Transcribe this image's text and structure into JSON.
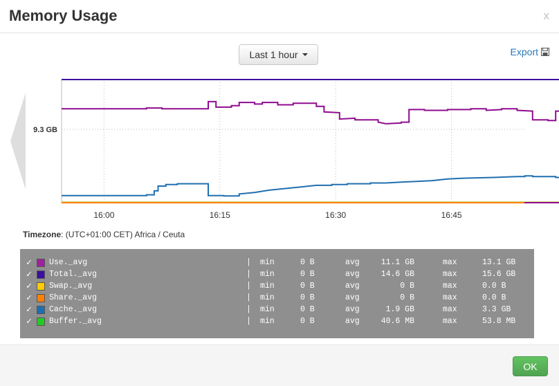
{
  "modal": {
    "title": "Memory Usage",
    "close_label": "x",
    "range_label": "Last 1 hour",
    "export_label": "Export",
    "ok_label": "OK"
  },
  "timezone": {
    "label": "Timezone",
    "value": ": (UTC+01:00 CET) Africa / Ceuta"
  },
  "chart_data": {
    "type": "line",
    "x_ticks": [
      "16:00",
      "16:15",
      "16:30",
      "16:45"
    ],
    "y_ticks": [
      {
        "label": "9.3 GB",
        "value": 9.3
      }
    ],
    "ylim": [
      0,
      15.6
    ],
    "grid": true,
    "series": [
      {
        "name": "Use._avg",
        "color": "#8f0b8f",
        "points": [
          [
            0,
            11.9
          ],
          [
            11,
            11.9
          ],
          [
            11,
            12.0
          ],
          [
            13,
            12.0
          ],
          [
            13,
            11.9
          ],
          [
            19,
            11.9
          ],
          [
            19,
            12.8
          ],
          [
            20,
            12.8
          ],
          [
            20,
            12.1
          ],
          [
            22,
            12.1
          ],
          [
            22,
            12.3
          ],
          [
            23,
            12.3
          ],
          [
            23,
            12.7
          ],
          [
            25,
            12.7
          ],
          [
            25,
            12.5
          ],
          [
            26,
            12.5
          ],
          [
            26,
            12.7
          ],
          [
            28,
            12.7
          ],
          [
            28,
            12.4
          ],
          [
            30,
            12.4
          ],
          [
            30,
            12.6
          ],
          [
            33,
            12.6
          ],
          [
            33,
            12.2
          ],
          [
            34,
            12.2
          ],
          [
            34,
            11.5
          ],
          [
            36,
            11.4
          ],
          [
            36,
            10.6
          ],
          [
            38,
            10.7
          ],
          [
            38,
            10.5
          ],
          [
            41,
            10.5
          ],
          [
            41,
            10.2
          ],
          [
            42,
            10.0
          ],
          [
            44,
            10.1
          ],
          [
            44,
            10.2
          ],
          [
            45,
            10.2
          ],
          [
            45,
            11.8
          ],
          [
            47,
            11.8
          ],
          [
            47,
            11.7
          ],
          [
            50,
            11.7
          ],
          [
            50,
            11.8
          ],
          [
            53,
            11.8
          ],
          [
            53,
            11.9
          ],
          [
            55,
            11.9
          ],
          [
            55,
            11.7
          ],
          [
            57,
            11.8
          ],
          [
            57,
            11.9
          ],
          [
            59,
            11.9
          ],
          [
            59,
            11.7
          ],
          [
            61,
            11.6
          ],
          [
            61,
            10.5
          ],
          [
            63,
            10.5
          ],
          [
            63,
            10.4
          ],
          [
            64,
            10.4
          ],
          [
            64,
            11.6
          ],
          [
            65,
            11.6
          ],
          [
            65,
            11.9
          ],
          [
            67,
            11.9
          ],
          [
            67,
            12.0
          ],
          [
            69,
            12.0
          ],
          [
            69,
            11.8
          ],
          [
            70,
            11.8
          ],
          [
            70,
            12.0
          ],
          [
            71,
            12.0
          ],
          [
            71,
            11.9
          ],
          [
            71.5,
            11.9
          ],
          [
            71.5,
            0
          ]
        ]
      },
      {
        "name": "Total._avg",
        "color": "#3a0fa0",
        "points": [
          [
            0,
            15.6
          ],
          [
            71.5,
            15.6
          ],
          [
            71.5,
            0
          ]
        ]
      },
      {
        "name": "Swap._avg",
        "color": "#f0c800",
        "points": [
          [
            0,
            0
          ],
          [
            71.5,
            0
          ]
        ]
      },
      {
        "name": "Share._avg",
        "color": "#ff7f00",
        "points": [
          [
            0,
            0
          ],
          [
            71.5,
            0
          ]
        ]
      },
      {
        "name": "Cache._avg",
        "color": "#1f6fb0",
        "points": [
          [
            0,
            0.9
          ],
          [
            11,
            0.9
          ],
          [
            11,
            1.0
          ],
          [
            12,
            1.0
          ],
          [
            12,
            1.5
          ],
          [
            12.5,
            1.5
          ],
          [
            12.5,
            2.1
          ],
          [
            13.5,
            2.1
          ],
          [
            13.5,
            2.3
          ],
          [
            15,
            2.3
          ],
          [
            15,
            2.4
          ],
          [
            19,
            2.4
          ],
          [
            19,
            0.9
          ],
          [
            21,
            0.9
          ],
          [
            21,
            0.85
          ],
          [
            23,
            0.85
          ],
          [
            23,
            1.1
          ],
          [
            25,
            1.3
          ],
          [
            27,
            1.6
          ],
          [
            29,
            1.8
          ],
          [
            31,
            2.0
          ],
          [
            33,
            2.2
          ],
          [
            35,
            2.2
          ],
          [
            35,
            2.3
          ],
          [
            37,
            2.3
          ],
          [
            37,
            2.4
          ],
          [
            40,
            2.4
          ],
          [
            40,
            2.5
          ],
          [
            42,
            2.5
          ],
          [
            44,
            2.6
          ],
          [
            46,
            2.7
          ],
          [
            48,
            2.8
          ],
          [
            50,
            3.0
          ],
          [
            52,
            3.1
          ],
          [
            56,
            3.2
          ],
          [
            59,
            3.3
          ],
          [
            60,
            3.3
          ],
          [
            60,
            3.4
          ],
          [
            61,
            3.4
          ],
          [
            61,
            3.3
          ],
          [
            64,
            3.3
          ],
          [
            64,
            3.2
          ],
          [
            65,
            3.2
          ],
          [
            65,
            2.6
          ],
          [
            67,
            2.5
          ],
          [
            71.5,
            2.5
          ],
          [
            71.5,
            0
          ]
        ]
      },
      {
        "name": "Buffer._avg",
        "color": "#b0cc30",
        "points": [
          [
            0,
            0.05
          ],
          [
            71.5,
            0.05
          ]
        ]
      }
    ]
  },
  "legend": {
    "rows": [
      {
        "name": "Use._avg",
        "color": "#a020a0",
        "min_label": "min",
        "min": "0 B",
        "avg_label": "avg",
        "avg": "11.1 GB",
        "max_label": "max",
        "max": "13.1 GB"
      },
      {
        "name": "Total._avg",
        "color": "#3a0fa0",
        "min_label": "min",
        "min": "0 B",
        "avg_label": "avg",
        "avg": "14.6 GB",
        "max_label": "max",
        "max": "15.6 GB"
      },
      {
        "name": "Swap._avg",
        "color": "#ffcc00",
        "min_label": "min",
        "min": "0 B",
        "avg_label": "avg",
        "avg": "0 B",
        "max_label": "max",
        "max": "0.0 B"
      },
      {
        "name": "Share._avg",
        "color": "#ff7f00",
        "min_label": "min",
        "min": "0 B",
        "avg_label": "avg",
        "avg": "0 B",
        "max_label": "max",
        "max": "0.0 B"
      },
      {
        "name": "Cache._avg",
        "color": "#1f6fb0",
        "min_label": "min",
        "min": "0 B",
        "avg_label": "avg",
        "avg": "1.9 GB",
        "max_label": "max",
        "max": "3.3 GB"
      },
      {
        "name": "Buffer._avg",
        "color": "#22cc22",
        "min_label": "min",
        "min": "0 B",
        "avg_label": "avg",
        "avg": "40.6 MB",
        "max_label": "max",
        "max": "53.8 MB"
      }
    ]
  },
  "icons": {
    "check": "✓",
    "save": "save-icon",
    "prev": "prev-arrow-icon"
  }
}
